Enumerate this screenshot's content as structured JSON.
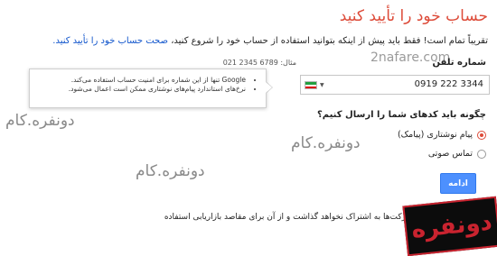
{
  "page": {
    "title": "حساب خود را تأیید کنید",
    "intro_text": "تقریباً تمام است! فقط باید پیش از اینکه بتوانید استفاده از حساب خود را شروع کنید،",
    "intro_link": "صحت حساب خود را تأیید کنید."
  },
  "phone": {
    "label": "شماره تلفن",
    "example": "مثال: 6789 2345 021",
    "value": "0919 222 3344",
    "country_flag": "iran-flag-icon"
  },
  "tooltip": {
    "line1": "Google تنها از این شماره برای امنیت حساب استفاده می‌کند.",
    "line2": "نرخ‌های استاندارد پیام‌های نوشتاری ممکن است اعمال می‌شود."
  },
  "delivery": {
    "question": "چگونه باید کدهای شما را ارسال کنیم؟",
    "options": [
      {
        "label": "پیام نوشتاری (پیامک)",
        "checked": true
      },
      {
        "label": "تماس صوتی",
        "checked": false
      }
    ]
  },
  "continue_label": "ادامه",
  "footer_text": "شماره شما را با دیگر شرکت‌ها به اشتراک نخواهد گذاشت و از آن برای مقاصد بازاریابی استفاده",
  "watermarks": {
    "top": "2nafare.com",
    "w1": "دونفره.کام",
    "w2": "دونفره.کام",
    "w3": "دونفره.کام",
    "logo": "دونفره"
  },
  "colors": {
    "title_red": "#dd4b39",
    "link_blue": "#1155cc",
    "button_blue": "#4d90fe"
  }
}
